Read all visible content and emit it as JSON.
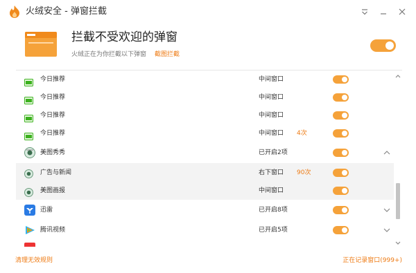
{
  "app": {
    "title": "火绒安全 - 弹窗拦截",
    "accent": "#ee7b14",
    "toggle_color": "#f5a23a"
  },
  "window_controls": {
    "menu_icon": "dropdown-menu-icon",
    "minimize_icon": "minimize-icon",
    "close_icon": "close-icon"
  },
  "header": {
    "icon": "window-popup-icon",
    "title": "拦截不受欢迎的弹窗",
    "description": "火绒正在为你拦截以下弹窗",
    "link": "截图拦截",
    "master_toggle_on": true
  },
  "rows": [
    {
      "name": "今日推荐",
      "position": "中间窗口",
      "count": "",
      "enabled": true,
      "icon": "jinri-app-icon",
      "sub": false
    },
    {
      "name": "今日推荐",
      "position": "中间窗口",
      "count": "",
      "enabled": true,
      "icon": "jinri-app-icon",
      "sub": false
    },
    {
      "name": "今日推荐",
      "position": "中间窗口",
      "count": "",
      "enabled": true,
      "icon": "jinri-app-icon",
      "sub": false
    },
    {
      "name": "今日推荐",
      "position": "中间窗口",
      "count": "4次",
      "enabled": true,
      "icon": "jinri-app-icon",
      "sub": false
    },
    {
      "name": "美图秀秀",
      "position": "已开启2项",
      "count": "",
      "enabled": true,
      "icon": "meitu-app-icon",
      "sub": false,
      "expand": "up"
    },
    {
      "name": "广告与新闻",
      "position": "右下窗口",
      "count": "90次",
      "enabled": true,
      "icon": "meitu-small-icon",
      "sub": true
    },
    {
      "name": "美图画报",
      "position": "中间窗口",
      "count": "",
      "enabled": true,
      "icon": "meitu-small-icon",
      "sub": true
    },
    {
      "name": "迅雷",
      "position": "已开启8项",
      "count": "",
      "enabled": true,
      "icon": "xunlei-app-icon",
      "sub": false,
      "expand": "down"
    },
    {
      "name": "腾讯视频",
      "position": "已开启5项",
      "count": "",
      "enabled": true,
      "icon": "tencent-video-icon",
      "sub": false,
      "expand": "down"
    }
  ],
  "footer": {
    "left": "清理无效规则",
    "right": "正在记录窗口(999+)"
  }
}
